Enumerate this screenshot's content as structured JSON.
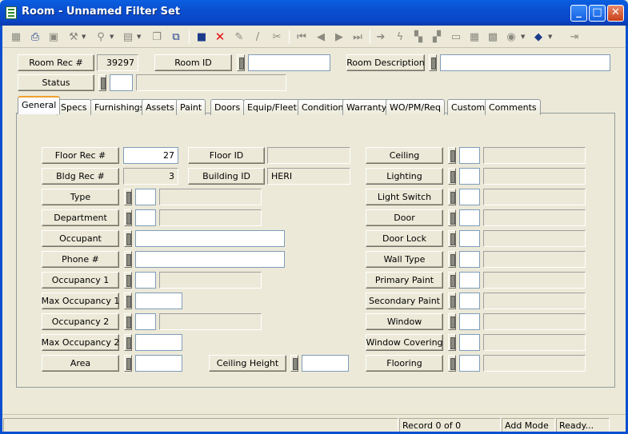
{
  "window": {
    "title": "Room - Unnamed Filter Set",
    "min": "_",
    "max": "□",
    "close": "✕"
  },
  "header": {
    "room_rec_label": "Room Rec #",
    "room_rec_value": "39297",
    "room_id_label": "Room ID",
    "room_id_value": "",
    "room_desc_label": "Room Description",
    "room_desc_value": "",
    "status_label": "Status",
    "status_code": "",
    "status_desc": ""
  },
  "tabs": [
    "General",
    "Specs",
    "Furnishings",
    "Assets",
    "Paint",
    "Doors",
    "Equip/Fleet",
    "Condition",
    "Warranty",
    "WO/PM/Req",
    "Custom",
    "Comments"
  ],
  "general": {
    "floor_rec_label": "Floor Rec #",
    "floor_rec_value": "27",
    "floor_id_label": "Floor ID",
    "floor_id_value": "",
    "bldg_rec_label": "Bldg Rec #",
    "bldg_rec_value": "3",
    "building_id_label": "Building ID",
    "building_id_value": "HERI",
    "type_label": "Type",
    "department_label": "Department",
    "occupant_label": "Occupant",
    "phone_label": "Phone #",
    "occupancy1_label": "Occupancy 1",
    "max_occupancy1_label": "Max Occupancy 1",
    "occupancy2_label": "Occupancy 2",
    "max_occupancy2_label": "Max Occupancy 2",
    "area_label": "Area",
    "ceiling_height_label": "Ceiling Height",
    "ceiling_label": "Ceiling",
    "lighting_label": "Lighting",
    "light_switch_label": "Light Switch",
    "door_label": "Door",
    "door_lock_label": "Door Lock",
    "wall_type_label": "Wall Type",
    "primary_paint_label": "Primary Paint",
    "secondary_paint_label": "Secondary Paint",
    "window_label": "Window",
    "window_covering_label": "Window Covering",
    "flooring_label": "Flooring"
  },
  "status": {
    "record": "Record 0 of 0",
    "mode": "Add Mode",
    "state": "Ready..."
  },
  "toolbar": {
    "icons": [
      "grid-icon",
      "print-icon",
      "preview-icon",
      "tools-icon",
      "filter-icon",
      "report-icon",
      "copy-icon",
      "export-icon",
      "save-icon",
      "delete-icon",
      "attach-icon",
      "edit-icon",
      "cut-icon",
      "first-icon",
      "prev-icon",
      "next-icon",
      "last-icon",
      "go-icon",
      "lightning-icon",
      "tree-icon",
      "hierarchy-icon",
      "form-icon",
      "calendar-icon",
      "map-icon",
      "globe-icon",
      "book-icon",
      "exit-icon"
    ]
  }
}
